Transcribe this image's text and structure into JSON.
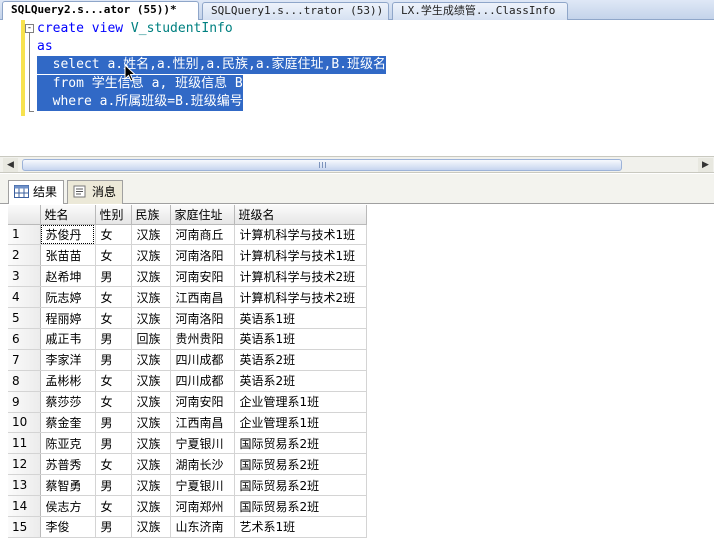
{
  "tabs": [
    {
      "label": "SQLQuery2.s...ator (55))*",
      "active": true
    },
    {
      "label": "SQLQuery1.s...trator (53))",
      "active": false
    },
    {
      "label": "LX.学生成绩管...ClassInfo",
      "active": false
    }
  ],
  "editor": {
    "line1_kw": "create view",
    "line1_id": "V_studentInfo",
    "line2": "as",
    "line3": "  select a.姓名,a.性别,a.民族,a.家庭住址,B.班级名",
    "line4": "  from 学生信息 a, 班级信息 B",
    "line5": "  where a.所属班级=B.班级编号",
    "fold_symbol": "-"
  },
  "result_tabs": {
    "results": "结果",
    "messages": "消息"
  },
  "grid": {
    "columns": [
      "姓名",
      "性别",
      "民族",
      "家庭住址",
      "班级名"
    ],
    "rows": [
      [
        "1",
        "苏俊丹",
        "女",
        "汉族",
        "河南商丘",
        "计算机科学与技术1班"
      ],
      [
        "2",
        "张苗苗",
        "女",
        "汉族",
        "河南洛阳",
        "计算机科学与技术1班"
      ],
      [
        "3",
        "赵希坤",
        "男",
        "汉族",
        "河南安阳",
        "计算机科学与技术2班"
      ],
      [
        "4",
        "阮志婷",
        "女",
        "汉族",
        "江西南昌",
        "计算机科学与技术2班"
      ],
      [
        "5",
        "程丽婷",
        "女",
        "汉族",
        "河南洛阳",
        "英语系1班"
      ],
      [
        "6",
        "戚正韦",
        "男",
        "回族",
        "贵州贵阳",
        "英语系1班"
      ],
      [
        "7",
        "李家洋",
        "男",
        "汉族",
        "四川成都",
        "英语系2班"
      ],
      [
        "8",
        "孟彬彬",
        "女",
        "汉族",
        "四川成都",
        "英语系2班"
      ],
      [
        "9",
        "蔡莎莎",
        "女",
        "汉族",
        "河南安阳",
        "企业管理系1班"
      ],
      [
        "10",
        "蔡金奎",
        "男",
        "汉族",
        "江西南昌",
        "企业管理系1班"
      ],
      [
        "11",
        "陈亚克",
        "男",
        "汉族",
        "宁夏银川",
        "国际贸易系2班"
      ],
      [
        "12",
        "苏普秀",
        "女",
        "汉族",
        "湖南长沙",
        "国际贸易系2班"
      ],
      [
        "13",
        "蔡智勇",
        "男",
        "汉族",
        "宁夏银川",
        "国际贸易系2班"
      ],
      [
        "14",
        "侯志方",
        "女",
        "汉族",
        "河南郑州",
        "国际贸易系2班"
      ],
      [
        "15",
        "李俊",
        "男",
        "汉族",
        "山东济南",
        "艺术系1班"
      ]
    ]
  },
  "colors": {
    "selection": "#3169c6",
    "keyword": "#0000ff",
    "identifier": "#008080"
  }
}
